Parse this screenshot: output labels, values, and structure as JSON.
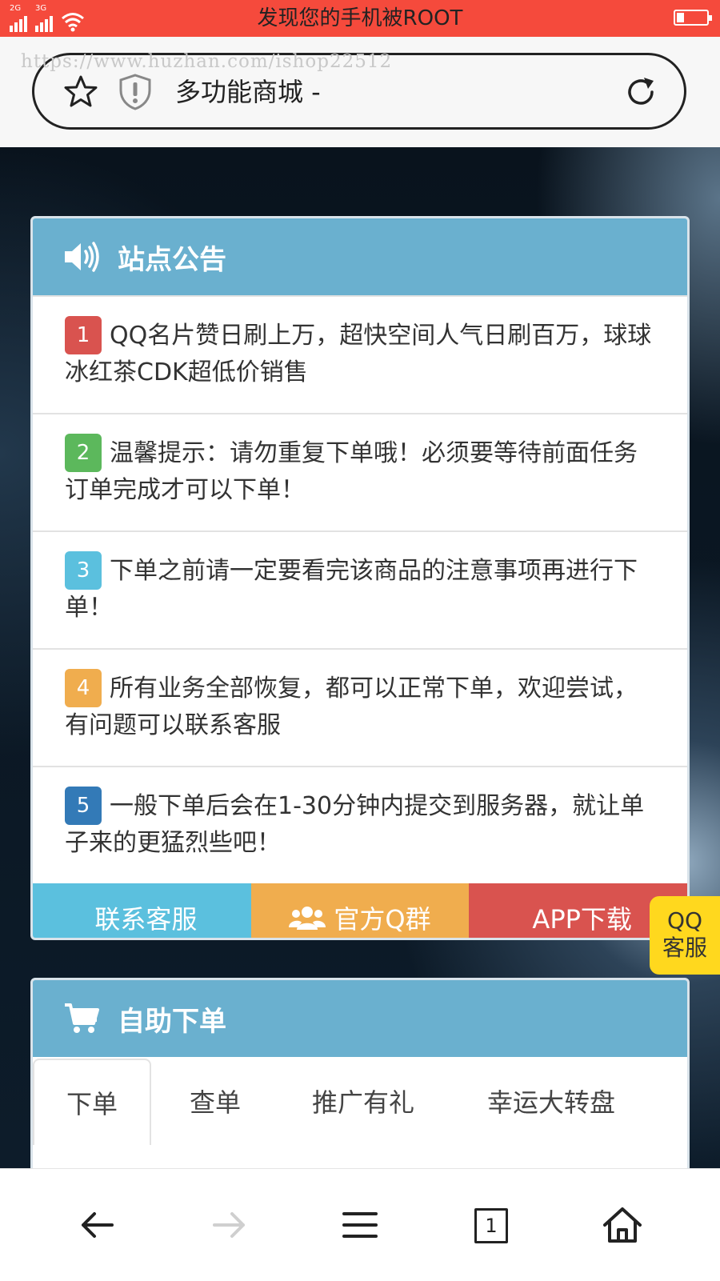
{
  "status_bar": {
    "title": "发现您的手机被ROOT",
    "signal_1": "2G",
    "signal_2": "3G",
    "icons": [
      "signal-2g-icon",
      "signal-3g-icon",
      "wifi-icon",
      "battery-icon"
    ],
    "background": "#f54a3c"
  },
  "browser": {
    "watermark": "https://www.huzhan.com/ishop22512",
    "page_title": "多功能商城 -",
    "icons": [
      "star-icon",
      "shield-warning-icon",
      "reload-icon"
    ]
  },
  "notice_panel": {
    "title": "站点公告",
    "icon": "speaker-icon",
    "items": [
      {
        "num": "1",
        "text": "QQ名片赞日刷上万，超快空间人气日刷百万，球球冰红茶CDK超低价销售",
        "color": "#d9534f"
      },
      {
        "num": "2",
        "text": "温馨提示：请勿重复下单哦！必须要等待前面任务订单完成才可以下单！",
        "color": "#5cb85c"
      },
      {
        "num": "3",
        "text": "下单之前请一定要看完该商品的注意事项再进行下单！",
        "color": "#5bc0de"
      },
      {
        "num": "4",
        "text": "所有业务全部恢复，都可以正常下单，欢迎尝试，有问题可以联系客服",
        "color": "#f0ad4e"
      },
      {
        "num": "5",
        "text": "一般下单后会在1-30分钟内提交到服务器，就让单子来的更猛烈些吧！",
        "color": "#337ab7"
      }
    ],
    "buttons": {
      "contact_icon": "",
      "contact": "联系客服",
      "group": "官方Q群",
      "app_icon": "",
      "app": "APP下载"
    }
  },
  "qq_float": {
    "line1": "QQ",
    "line2": "客服"
  },
  "order_panel": {
    "title": "自助下单",
    "icon": "cart-icon",
    "tabs": [
      "下单",
      "查单",
      "推广有礼",
      "幸运大转盘"
    ]
  },
  "bottom_nav": {
    "tab_count": "1",
    "icons": [
      "back-arrow-icon",
      "forward-arrow-icon",
      "menu-icon",
      "tabs-icon",
      "home-icon"
    ]
  },
  "colors": {
    "panel_header": "#6ab0cf",
    "accent_info": "#5bc0de",
    "accent_warning": "#f0ad4e",
    "accent_danger": "#d9534f",
    "qq_float": "#ffd81e"
  }
}
